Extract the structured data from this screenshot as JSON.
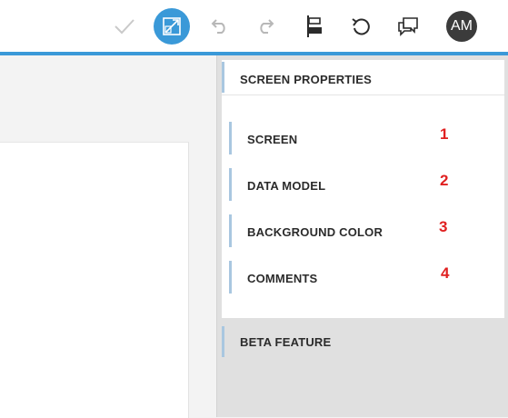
{
  "colors": {
    "accent": "#3a99d8",
    "bar": "#a9c7e0",
    "number": "#e02020",
    "avatar": "#3b3b3b"
  },
  "toolbar": {
    "icons": [
      "checkmark-icon",
      "inspector-icon",
      "undo-icon",
      "redo-icon",
      "align-icon",
      "refresh-icon",
      "comments-icon"
    ],
    "avatar_initials": "AM"
  },
  "panel": {
    "header": "SCREEN PROPERTIES",
    "items": [
      {
        "label": "SCREEN",
        "number": "1"
      },
      {
        "label": "DATA MODEL",
        "number": "2"
      },
      {
        "label": "BACKGROUND COLOR",
        "number": "3"
      },
      {
        "label": "COMMENTS",
        "number": "4"
      }
    ],
    "beta": "BETA FEATURE"
  }
}
